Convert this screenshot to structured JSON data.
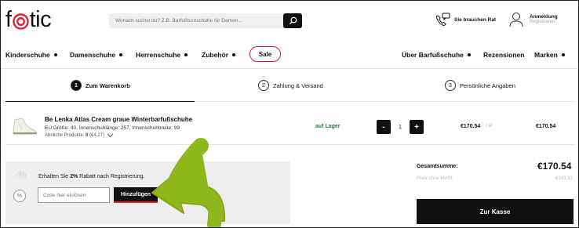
{
  "brand": {
    "logo_left": "f",
    "logo_right": "tic",
    "accent_color": "#e11d2b"
  },
  "search": {
    "placeholder": "Wonach suchst du? Z.B. Barfußturnschuhe für Damen..."
  },
  "header": {
    "help_label": "Sie brauchen Rat",
    "account_title": "Anmeldung",
    "account_subtitle": "Registrieren"
  },
  "nav": {
    "items": [
      "Kinderschuhe",
      "Damenschuhe",
      "Herrenschuhe",
      "Zubehör"
    ],
    "sale": "Sale",
    "right_items": [
      "Über Barfußschuhe",
      "Rezensionen",
      "Marken"
    ]
  },
  "steps": [
    {
      "number": "1",
      "label": "Zum Warenkorb"
    },
    {
      "number": "2",
      "label": "Zahlung &  Versand"
    },
    {
      "number": "3",
      "label": "Persönliche Angaben"
    }
  ],
  "product": {
    "name": "Be Lenka Atlas Cream graue Winterbarfußschuhe",
    "attributes": "EU Größe: 40, Innenschuhlänge: 257, Innenschuhbreite: 99",
    "similar_label": "Ähnliche Produkte:",
    "similar_count": "8",
    "similar_price": "(€4.27)",
    "stock": "auf Lager",
    "quantity": "1",
    "minus": "-",
    "plus": "+",
    "unit_price": "€170.54",
    "unit_per": "/ st",
    "line_total": "€170.54"
  },
  "promo": {
    "pct_text": "-%",
    "badge": "%",
    "text_before": "Erhalten Sie ",
    "text_bold": "2%",
    "text_after": " Rabatt nach Registrierung.",
    "input_placeholder": "Code hier einlösen",
    "button_label": "Hinzufügen"
  },
  "totals": {
    "total_label": "Gesamtsumme:",
    "total_value": "€170.54",
    "net_label": "Preis ohne MwSt:",
    "net_value": "€143.31",
    "checkout_label": "Zur Kasse"
  },
  "icons": [
    "search-icon",
    "chat-phone-icon",
    "user-icon",
    "chevron-down-icon",
    "percent-icon",
    "arrow-annotation"
  ],
  "colors": {
    "arrow": "#8fb81c",
    "stock": "#2e7d32",
    "promo_bg": "#eeeeee"
  }
}
